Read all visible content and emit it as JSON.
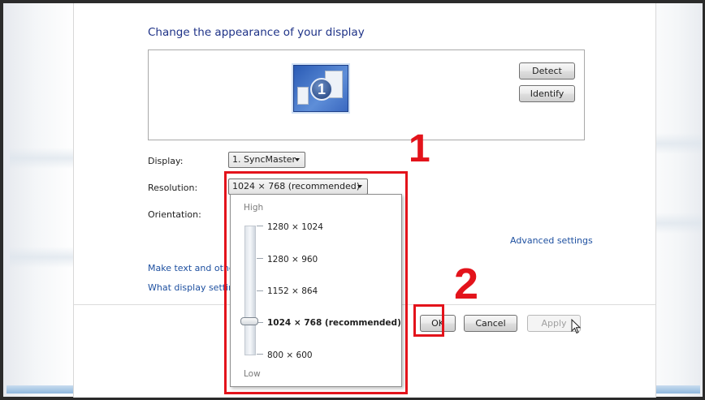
{
  "page": {
    "title": "Change the appearance of your display"
  },
  "preview": {
    "monitor_number": "1",
    "detect_button": "Detect",
    "identify_button": "Identify"
  },
  "fields": {
    "display_label": "Display:",
    "display_value": "1. SyncMaster",
    "resolution_label": "Resolution:",
    "resolution_value": "1024 × 768 (recommended)",
    "orientation_label": "Orientation:"
  },
  "links": {
    "advanced_settings": "Advanced settings",
    "make_text_other": "Make text and other",
    "what_display_settings": "What display settin"
  },
  "dropdown": {
    "high_label": "High",
    "low_label": "Low",
    "options": [
      "1280 × 1024",
      "1280 × 960",
      "1152 × 864",
      "1024 × 768 (recommended)",
      "800 × 600"
    ],
    "selected_index": 3
  },
  "footer": {
    "ok_button": "OK",
    "cancel_button": "Cancel",
    "apply_button": "Apply"
  },
  "annotations": {
    "step1": "1",
    "step2": "2",
    "color": "#e3131b"
  },
  "icons": {
    "monitor": "monitor-icon",
    "combo_arrow": "chevron-down-icon",
    "cursor": "mouse-cursor-icon"
  }
}
